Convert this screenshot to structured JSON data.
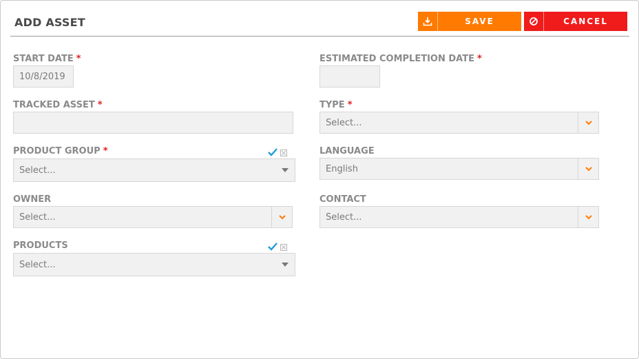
{
  "dialog": {
    "title": "ADD ASSET",
    "save_label": "SAVE",
    "cancel_label": "CANCEL",
    "colors": {
      "save": "#ff7a00",
      "cancel": "#f01b1b",
      "chevron": "#ff7a00",
      "check": "#1e9be0",
      "required": "#e02020"
    }
  },
  "fields": {
    "start_date": {
      "label": "START DATE",
      "required": "*",
      "value": "10/8/2019"
    },
    "estimated_completion_date": {
      "label": "ESTIMATED COMPLETION DATE",
      "required": "*",
      "value": ""
    },
    "tracked_asset": {
      "label": "TRACKED ASSET",
      "required": "*",
      "value": ""
    },
    "type": {
      "label": "TYPE",
      "required": "*",
      "value": "Select..."
    },
    "product_group": {
      "label": "PRODUCT GROUP",
      "required": "*",
      "value": "Select..."
    },
    "language": {
      "label": "LANGUAGE",
      "value": "English"
    },
    "owner": {
      "label": "OWNER",
      "value": "Select..."
    },
    "contact": {
      "label": "CONTACT",
      "value": "Select..."
    },
    "products": {
      "label": "PRODUCTS",
      "value": "Select..."
    }
  },
  "icons": {
    "save": "download-icon",
    "cancel": "ban-icon",
    "dropdown": "chevron-down-icon",
    "combo": "caret-down-icon",
    "select_all": "check-icon",
    "clear_all": "close-box-icon"
  }
}
